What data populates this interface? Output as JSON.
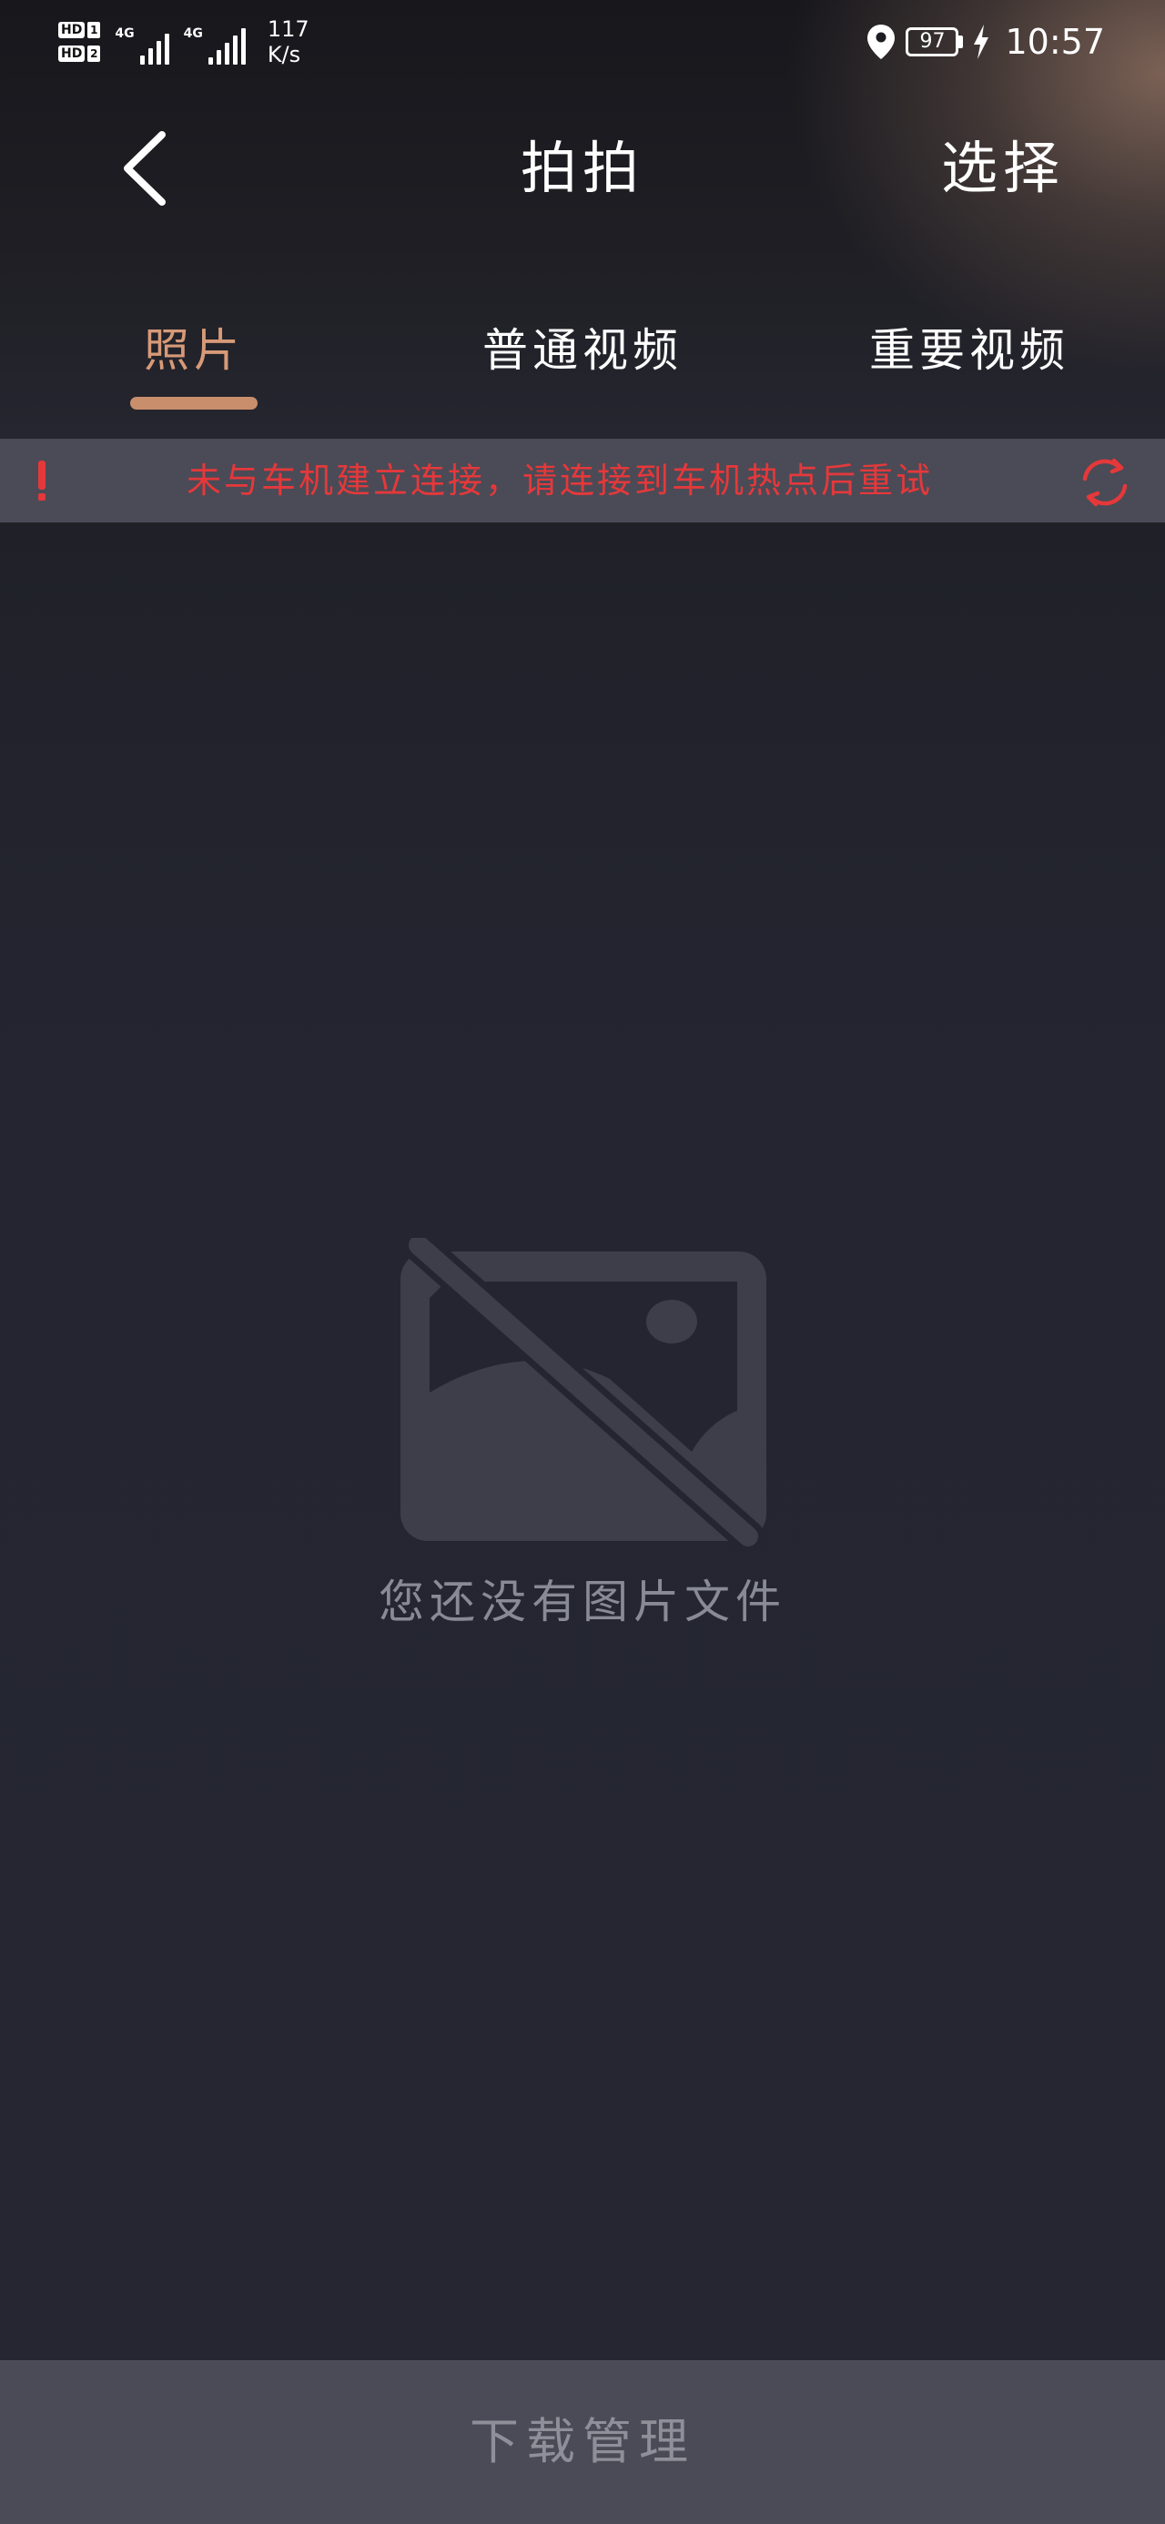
{
  "status_bar": {
    "sim1_tag": "HD",
    "sim1_num": "1",
    "sim2_tag": "HD",
    "sim2_num": "2",
    "network1": "4G",
    "network2": "4G",
    "speed_value": "117",
    "speed_unit": "K/s",
    "battery": "97",
    "time": "10:57"
  },
  "header": {
    "title": "拍拍",
    "select_label": "选择"
  },
  "tabs": [
    {
      "label": "照片",
      "active": true
    },
    {
      "label": "普通视频",
      "active": false
    },
    {
      "label": "重要视频",
      "active": false
    }
  ],
  "alert": {
    "message": "未与车机建立连接，请连接到车机热点后重试",
    "color": "#e5383b"
  },
  "empty_state": {
    "message": "您还没有图片文件",
    "icon": "no-image-icon"
  },
  "bottom_bar": {
    "label": "下载管理"
  },
  "colors": {
    "accent": "#d69a78",
    "background": "#242530",
    "bottom_bar": "#4a4b57"
  }
}
